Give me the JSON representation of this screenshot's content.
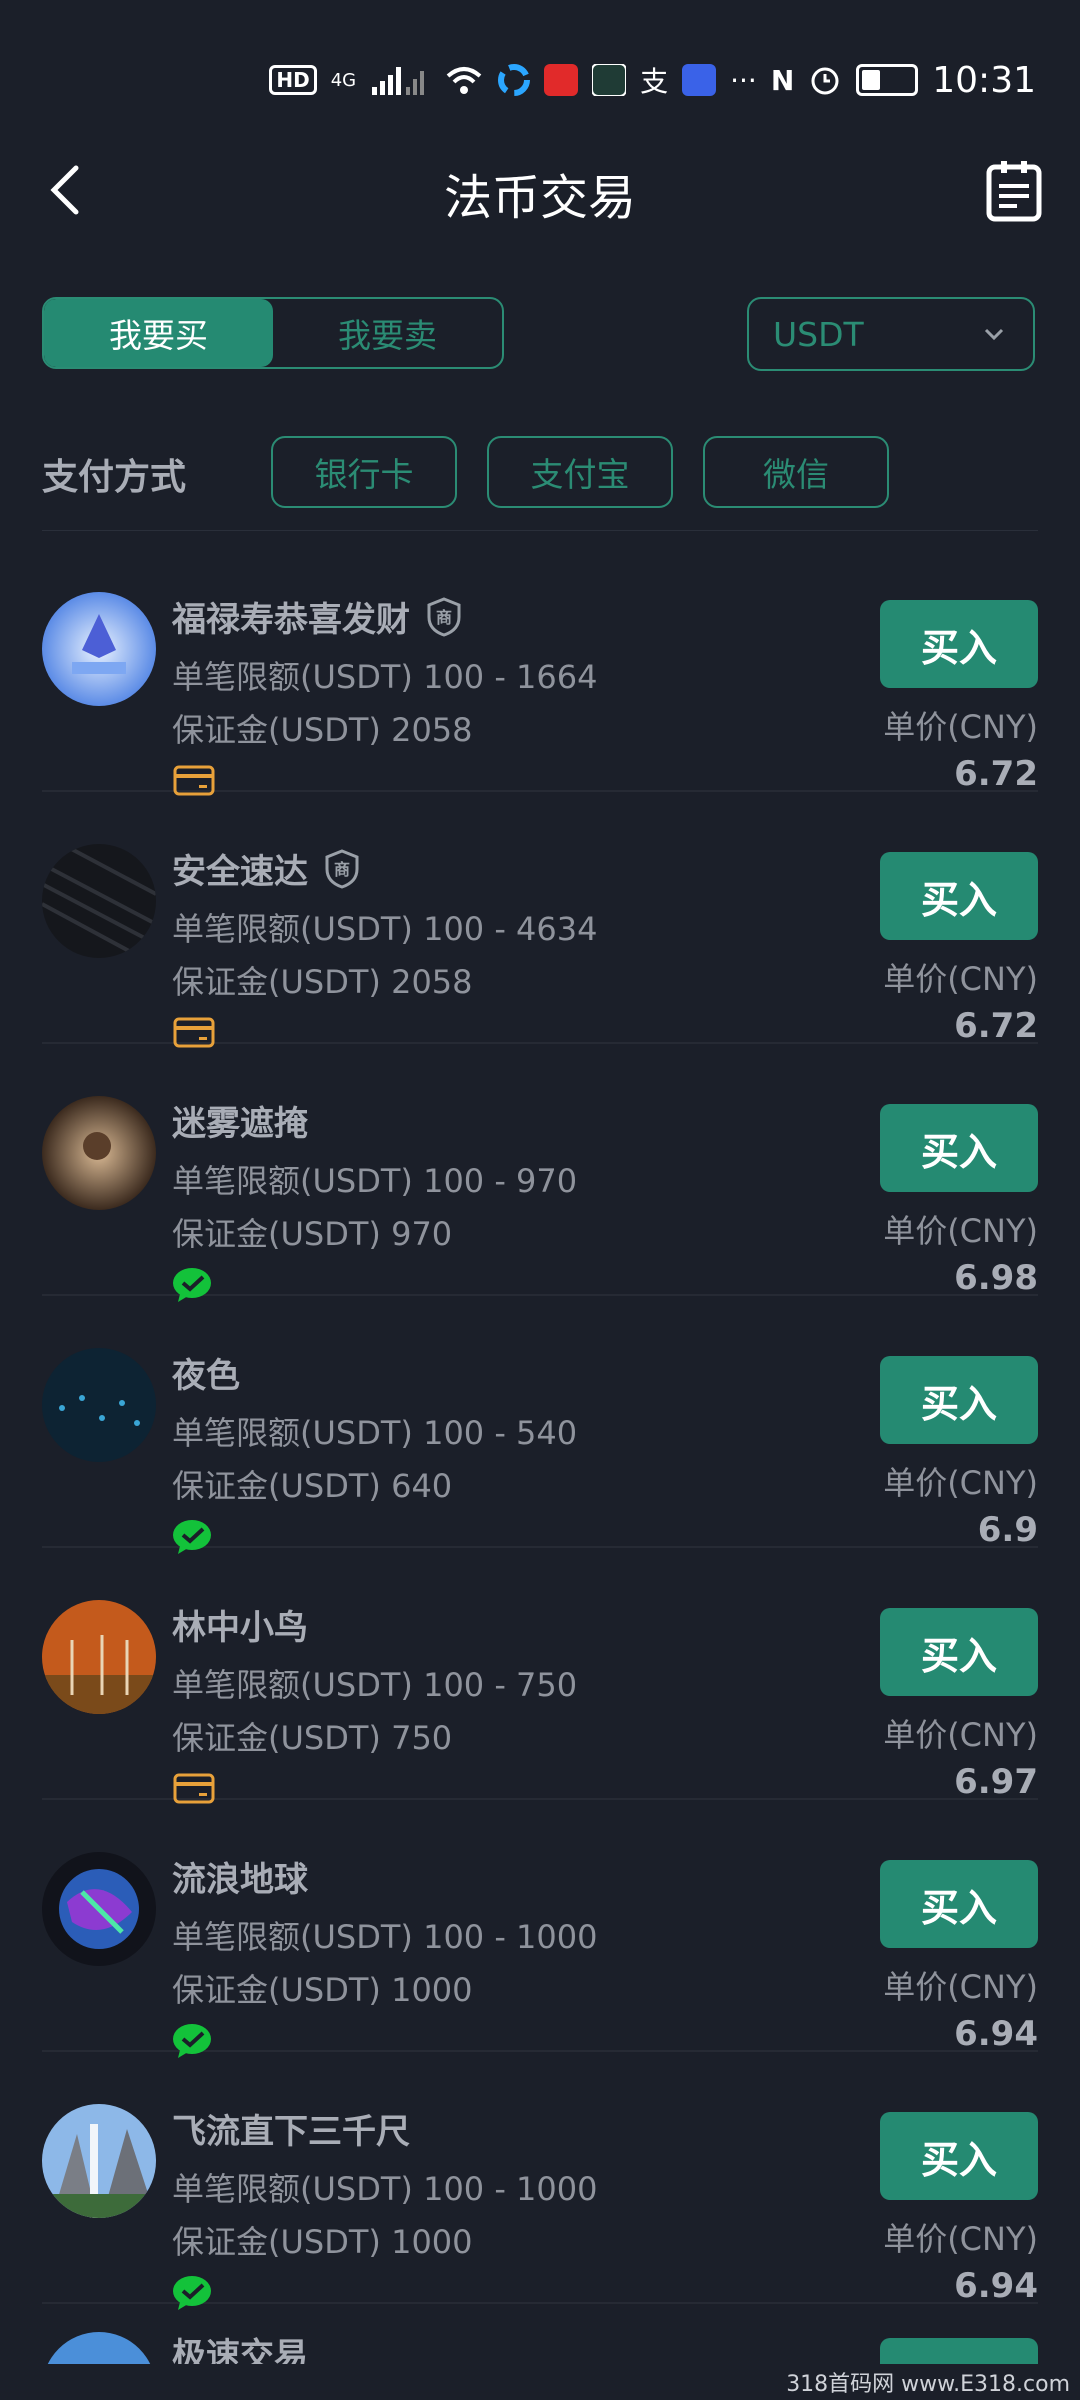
{
  "status": {
    "time": "10:31",
    "hd": "HD",
    "network": "4G",
    "icons": [
      "hd-icon",
      "signal-icon",
      "wifi-icon",
      "app-icon",
      "notification-icon",
      "nfc-icon",
      "alarm-icon",
      "battery-icon"
    ]
  },
  "header": {
    "title": "法币交易",
    "back_icon": "back-chevron-icon",
    "orders_icon": "order-list-icon"
  },
  "tabs": [
    {
      "label": "我要买",
      "active": true
    },
    {
      "label": "我要卖",
      "active": false
    }
  ],
  "currency": {
    "selected": "USDT"
  },
  "payment": {
    "label": "支付方式",
    "options": [
      "银行卡",
      "支付宝",
      "微信"
    ]
  },
  "labels": {
    "limit_prefix": "单笔限额(USDT) ",
    "deposit_prefix": "保证金(USDT) ",
    "price_label": "单价(CNY)",
    "buy": "买入"
  },
  "merchants": [
    {
      "name": "福禄寿恭喜发财",
      "verified": true,
      "limit": "100 - 1664",
      "deposit": "2058",
      "pay": "bank-card",
      "price": "6.72"
    },
    {
      "name": "安全速达",
      "verified": true,
      "limit": "100 - 4634",
      "deposit": "2058",
      "pay": "bank-card",
      "price": "6.72"
    },
    {
      "name": "迷雾遮掩",
      "verified": false,
      "limit": "100 - 970",
      "deposit": "970",
      "pay": "wechat",
      "price": "6.98"
    },
    {
      "name": "夜色",
      "verified": false,
      "limit": "100 - 540",
      "deposit": "640",
      "pay": "wechat",
      "price": "6.9"
    },
    {
      "name": "林中小鸟",
      "verified": false,
      "limit": "100 - 750",
      "deposit": "750",
      "pay": "bank-card",
      "price": "6.97"
    },
    {
      "name": "流浪地球",
      "verified": false,
      "limit": "100 - 1000",
      "deposit": "1000",
      "pay": "wechat",
      "price": "6.94"
    },
    {
      "name": "飞流直下三千尺",
      "verified": false,
      "limit": "100 - 1000",
      "deposit": "1000",
      "pay": "wechat",
      "price": "6.94"
    }
  ],
  "partial_row": {
    "name": "极速交易"
  },
  "watermark": "318首码网 www.E318.com",
  "colors": {
    "accent": "#258a72",
    "background": "#1b1f29",
    "bank_card": "#e8a13a",
    "wechat": "#13c23a"
  }
}
